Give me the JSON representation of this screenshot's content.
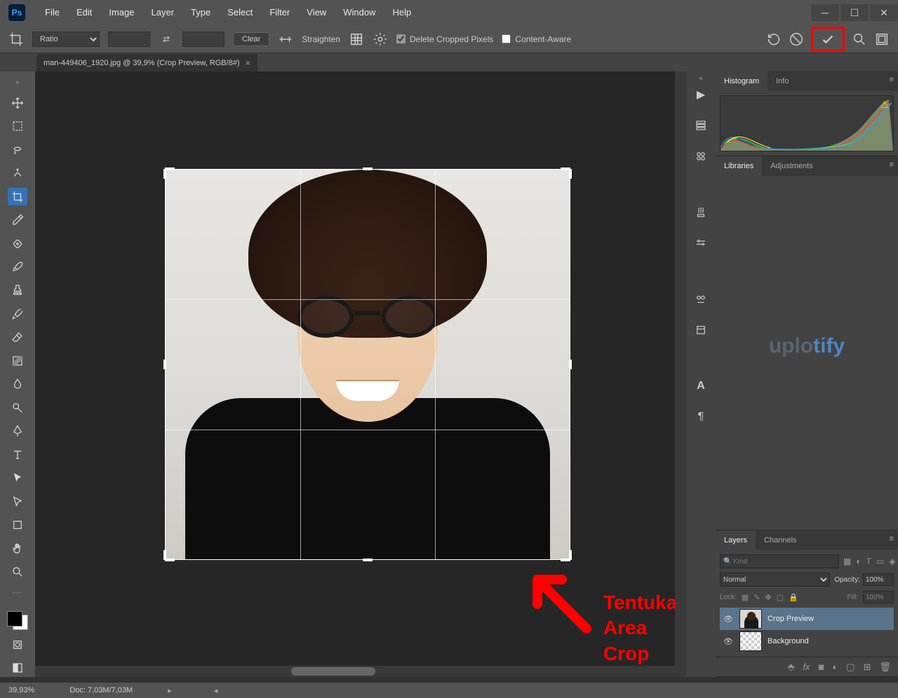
{
  "app": {
    "logo": "Ps"
  },
  "menu": [
    "File",
    "Edit",
    "Image",
    "Layer",
    "Type",
    "Select",
    "Filter",
    "View",
    "Window",
    "Help"
  ],
  "options": {
    "ratio_label": "Ratio",
    "clear": "Clear",
    "straighten": "Straighten",
    "delete_cropped": "Delete Cropped Pixels",
    "content_aware": "Content-Aware"
  },
  "tab": {
    "title": "man-449406_1920.jpg @ 39,9% (Crop Preview, RGB/8#)"
  },
  "annotation": {
    "line1": "Tentukan",
    "line2": "Area Crop"
  },
  "panels": {
    "histogram_tabs": [
      "Histogram",
      "Info"
    ],
    "lib_tabs": [
      "Libraries",
      "Adjustments"
    ],
    "layers_tabs": [
      "Layers",
      "Channels"
    ]
  },
  "watermark": {
    "plain": "uplo",
    "blue": "tify"
  },
  "layers": {
    "search_placeholder": "Kind",
    "blend": "Normal",
    "opacity_label": "Opacity:",
    "opacity_value": "100%",
    "lock_label": "Lock:",
    "fill_label": "Fill:",
    "fill_value": "100%",
    "items": [
      {
        "name": "Crop Preview",
        "selected": true
      },
      {
        "name": "Background",
        "selected": false
      }
    ]
  },
  "status": {
    "zoom": "39,93%",
    "doc": "Doc: 7,03M/7,03M"
  }
}
